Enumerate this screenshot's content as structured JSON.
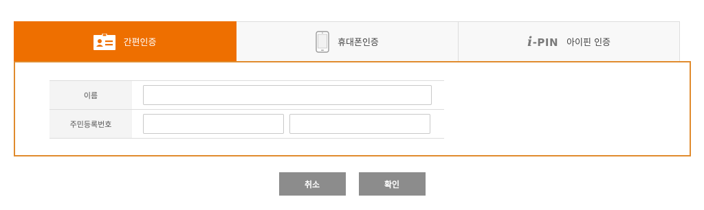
{
  "tabs": [
    {
      "label": "간편인증",
      "icon": "id-card-icon",
      "active": true
    },
    {
      "label": "휴대폰인증",
      "icon": "mobile-phone-icon",
      "active": false
    },
    {
      "label": "아이핀 인증",
      "icon": "ipin-logo",
      "logo_text_i": "i",
      "logo_text_rest": "-PIN",
      "active": false
    }
  ],
  "form": {
    "name_label": "이름",
    "name_value": "",
    "rrn_label": "주민등록번호",
    "rrn_front_value": "",
    "rrn_back_value": ""
  },
  "buttons": {
    "cancel_label": "취소",
    "confirm_label": "확인"
  },
  "colors": {
    "accent": "#ee6f00",
    "panel_border": "#e08a2c",
    "button_bg": "#8c8c8c"
  }
}
